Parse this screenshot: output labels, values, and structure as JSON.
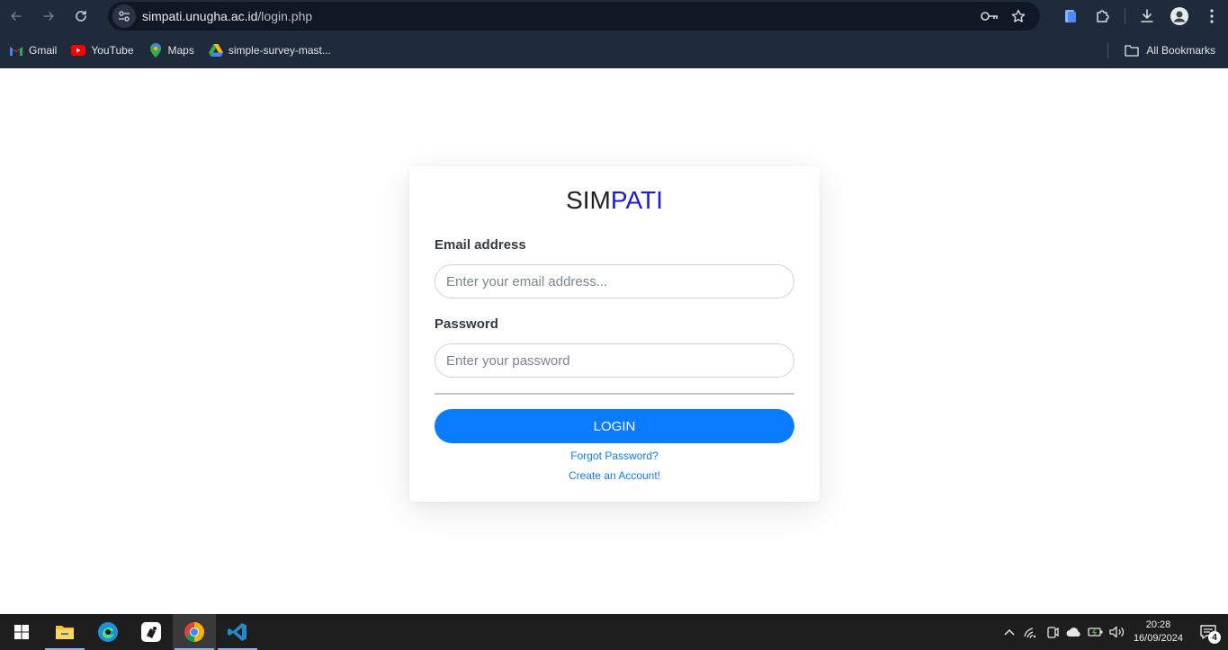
{
  "browser": {
    "url_host": "simpati.unugha.ac.id",
    "url_path": "/login.php",
    "bookmarks": [
      {
        "label": "Gmail",
        "icon": "gmail-icon"
      },
      {
        "label": "YouTube",
        "icon": "youtube-icon"
      },
      {
        "label": "Maps",
        "icon": "maps-icon"
      },
      {
        "label": "simple-survey-mast...",
        "icon": "drive-icon"
      }
    ],
    "all_bookmarks": "All Bookmarks"
  },
  "login": {
    "brand_part1": "SIM",
    "brand_part2": "PATI",
    "brand_color_part1": "#222222",
    "brand_color_part2": "#1a1ae6",
    "email_label": "Email address",
    "email_placeholder": "Enter your email address...",
    "password_label": "Password",
    "password_placeholder": "Enter your password",
    "login_button": "LOGIN",
    "forgot_link": "Forgot Password?",
    "create_link": "Create an Account!",
    "accent_color": "#0a7cff"
  },
  "taskbar": {
    "apps": [
      "start-icon",
      "file-explorer-icon",
      "edge-icon",
      "app-icon",
      "chrome-icon",
      "vscode-icon"
    ],
    "time": "20:28",
    "date": "16/09/2024",
    "notification_count": "4"
  }
}
